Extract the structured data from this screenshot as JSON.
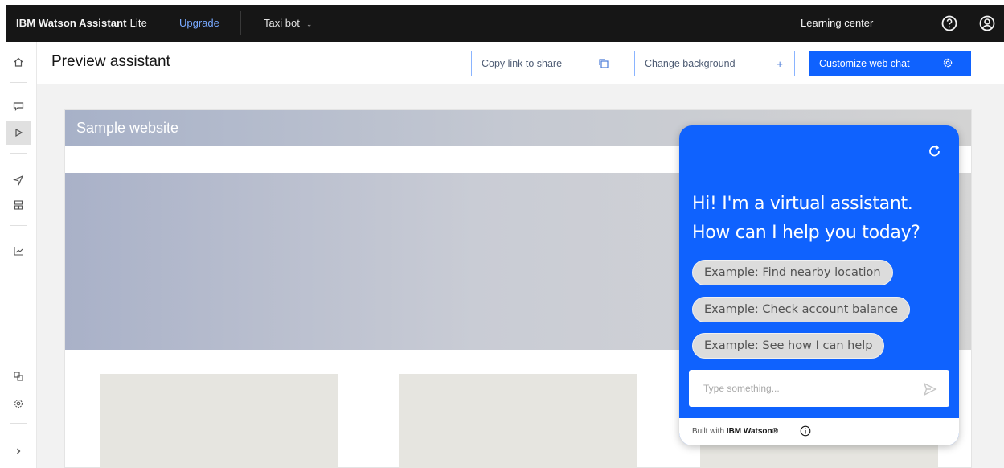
{
  "header": {
    "brand_bold": "IBM Watson Assistant",
    "brand_tier": "Lite",
    "upgrade_label": "Upgrade",
    "assistant_name": "Taxi bot",
    "learning_center_label": "Learning center",
    "icons": [
      "help-icon",
      "user-avatar-icon"
    ]
  },
  "sidebar": {
    "items": [
      {
        "icon": "home-icon"
      },
      {
        "icon": "chat-icon"
      },
      {
        "icon": "preview-play-icon",
        "active": true
      },
      {
        "icon": "publish-icon"
      },
      {
        "icon": "environments-icon"
      },
      {
        "icon": "analytics-icon"
      },
      {
        "icon": "integrations-icon"
      },
      {
        "icon": "settings-icon"
      },
      {
        "icon": "expand-chevron-icon"
      }
    ]
  },
  "page": {
    "title": "Preview assistant",
    "copy_link_label": "Copy link to share",
    "change_background_label": "Change background",
    "change_background_symbol": "+",
    "customize_label": "Customize web chat"
  },
  "preview": {
    "site_title": "Sample website"
  },
  "chat": {
    "greeting": "Hi! I'm a virtual assistant. How can I help you today?",
    "suggestions": [
      "Example: Find nearby location",
      "Example: Check account balance",
      "Example: See how I can help"
    ],
    "input_placeholder": "Type something...",
    "built_with_prefix": "Built with",
    "built_with_brand": "IBM Watson®"
  },
  "colors": {
    "primary": "#0f62fe",
    "topbar": "#161616",
    "link": "#78a9ff",
    "chip": "#dcdcdc",
    "canvas": "#f2f2f2"
  }
}
